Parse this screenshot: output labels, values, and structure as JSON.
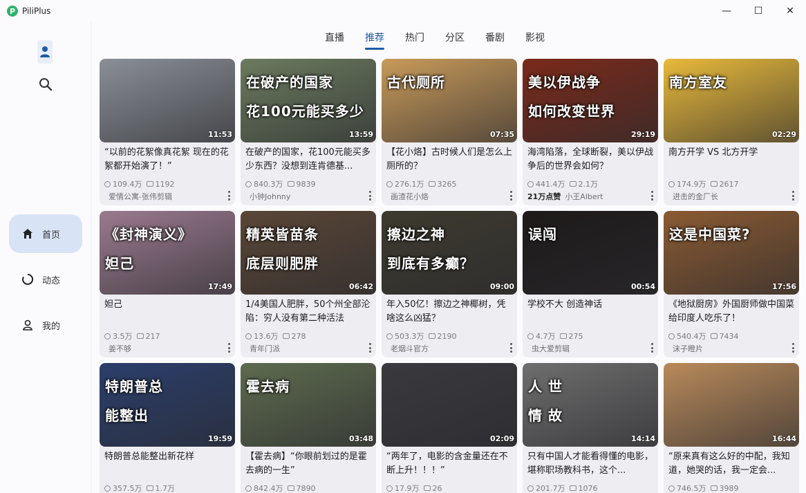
{
  "app": {
    "title": "PiliPlus",
    "logo_letter": "P"
  },
  "window_controls": {
    "minimize": "—",
    "maximize": "☐",
    "close": "✕"
  },
  "rail": {
    "items": [
      {
        "label": "首页",
        "icon": "home-icon",
        "active": true
      },
      {
        "label": "动态",
        "icon": "dynamic-icon",
        "active": false
      },
      {
        "label": "我的",
        "icon": "person-icon",
        "active": false
      }
    ]
  },
  "tabs": [
    {
      "label": "直播",
      "active": false
    },
    {
      "label": "推荐",
      "active": true
    },
    {
      "label": "热门",
      "active": false
    },
    {
      "label": "分区",
      "active": false
    },
    {
      "label": "番剧",
      "active": false
    },
    {
      "label": "影视",
      "active": false
    }
  ],
  "videos": [
    {
      "title": "“以前的花絮像真花絮 现在的花絮都开始演了！”",
      "duration": "11:53",
      "views": "109.4万",
      "danmaku": "1192",
      "author": "爱情公寓-张伟剪辑",
      "badge": "",
      "thumb": "#8a8f96",
      "caption": "",
      "caption2": ""
    },
    {
      "title": "在破产的国家，花100元能买多少东西？没想到连肯德基...",
      "duration": "13:59",
      "views": "840.3万",
      "danmaku": "9839",
      "author": "小钟Johnny",
      "badge": "",
      "thumb": "#6b7a5e",
      "caption": "在破产的国家",
      "caption2": "花100元能买多少"
    },
    {
      "title": "【花小烙】古时候人们是怎么上厕所的？",
      "duration": "07:35",
      "views": "276.1万",
      "danmaku": "3265",
      "author": "画渣花小烙",
      "badge": "",
      "thumb": "#c89a5a",
      "caption": "古代厕所",
      "caption2": ""
    },
    {
      "title": "海湾陷落，全球断裂，美以伊战争后的世界会如何？",
      "duration": "29:19",
      "views": "441.4万",
      "danmaku": "2.1万",
      "author": "小王Albert",
      "badge": "21万点赞",
      "thumb": "#7a2a1a",
      "caption": "美以伊战争",
      "caption2": "如何改变世界"
    },
    {
      "title": "南方开学 VS 北方开学",
      "duration": "02:29",
      "views": "174.9万",
      "danmaku": "2617",
      "author": "进击的金厂长",
      "badge": "",
      "thumb": "#e8b93a",
      "caption": "南方室友",
      "caption2": ""
    },
    {
      "title": "妲己",
      "duration": "17:49",
      "views": "3.5万",
      "danmaku": "217",
      "author": "姜不够",
      "badge": "",
      "thumb": "#9a7a8e",
      "caption": "《封神演义》",
      "caption2": "妲己"
    },
    {
      "title": "1/4美国人肥胖，50个州全部沦陷：穷人没有第二种活法",
      "duration": "06:42",
      "views": "13.6万",
      "danmaku": "278",
      "author": "青年门派",
      "badge": "",
      "thumb": "#5a4636",
      "caption": "精英皆苗条",
      "caption2": "底层则肥胖"
    },
    {
      "title": "年入50亿！擦边之神椰树，凭啥这么凶猛？",
      "duration": "09:00",
      "views": "503.3万",
      "danmaku": "2190",
      "author": "老烟斗官方",
      "badge": "",
      "thumb": "#3d3a2e",
      "caption": "擦边之神",
      "caption2": "到底有多癫？"
    },
    {
      "title": "学校不大 创造神话",
      "duration": "00:54",
      "views": "4.7万",
      "danmaku": "275",
      "author": "虫大爱剪辑",
      "badge": "",
      "thumb": "#1e1a1a",
      "caption": "误闯",
      "caption2": ""
    },
    {
      "title": "《地狱厨房》外国厨师做中国菜 给印度人吃乐了！",
      "duration": "17:56",
      "views": "540.4万",
      "danmaku": "7434",
      "author": "沫子瞪片",
      "badge": "",
      "thumb": "#8a5a32",
      "caption": "这是中国菜?",
      "caption2": ""
    },
    {
      "title": "特朗普总能整出新花样",
      "duration": "19:59",
      "views": "357.5万",
      "danmaku": "1.7万",
      "author": "",
      "badge": "",
      "thumb": "#2b3e6b",
      "caption": "特朗普总",
      "caption2": "能整出"
    },
    {
      "title": "【霍去病】“你眼前划过的是霍去病的一生”",
      "duration": "03:48",
      "views": "842.4万",
      "danmaku": "7890",
      "author": "",
      "badge": "",
      "thumb": "#5d6b4e",
      "caption": "霍去病",
      "caption2": ""
    },
    {
      "title": "“两年了，电影的含金量还在不断上升！！！”",
      "duration": "02:09",
      "views": "17.9万",
      "danmaku": "26",
      "author": "",
      "badge": "",
      "thumb": "#3a3a3e",
      "caption": "",
      "caption2": ""
    },
    {
      "title": "只有中国人才能看得懂的电影，堪称职场教科书，这个...",
      "duration": "14:14",
      "views": "201.7万",
      "danmaku": "1076",
      "author": "",
      "badge": "",
      "thumb": "#6e6e6e",
      "caption": "人 世",
      "caption2": "情 故"
    },
    {
      "title": "“原来真有这么好的中配，我知道，她哭的话，我一定会...",
      "duration": "16:44",
      "views": "746.5万",
      "danmaku": "3989",
      "author": "",
      "badge": "",
      "thumb": "#b88a5a",
      "caption": "",
      "caption2": ""
    }
  ]
}
